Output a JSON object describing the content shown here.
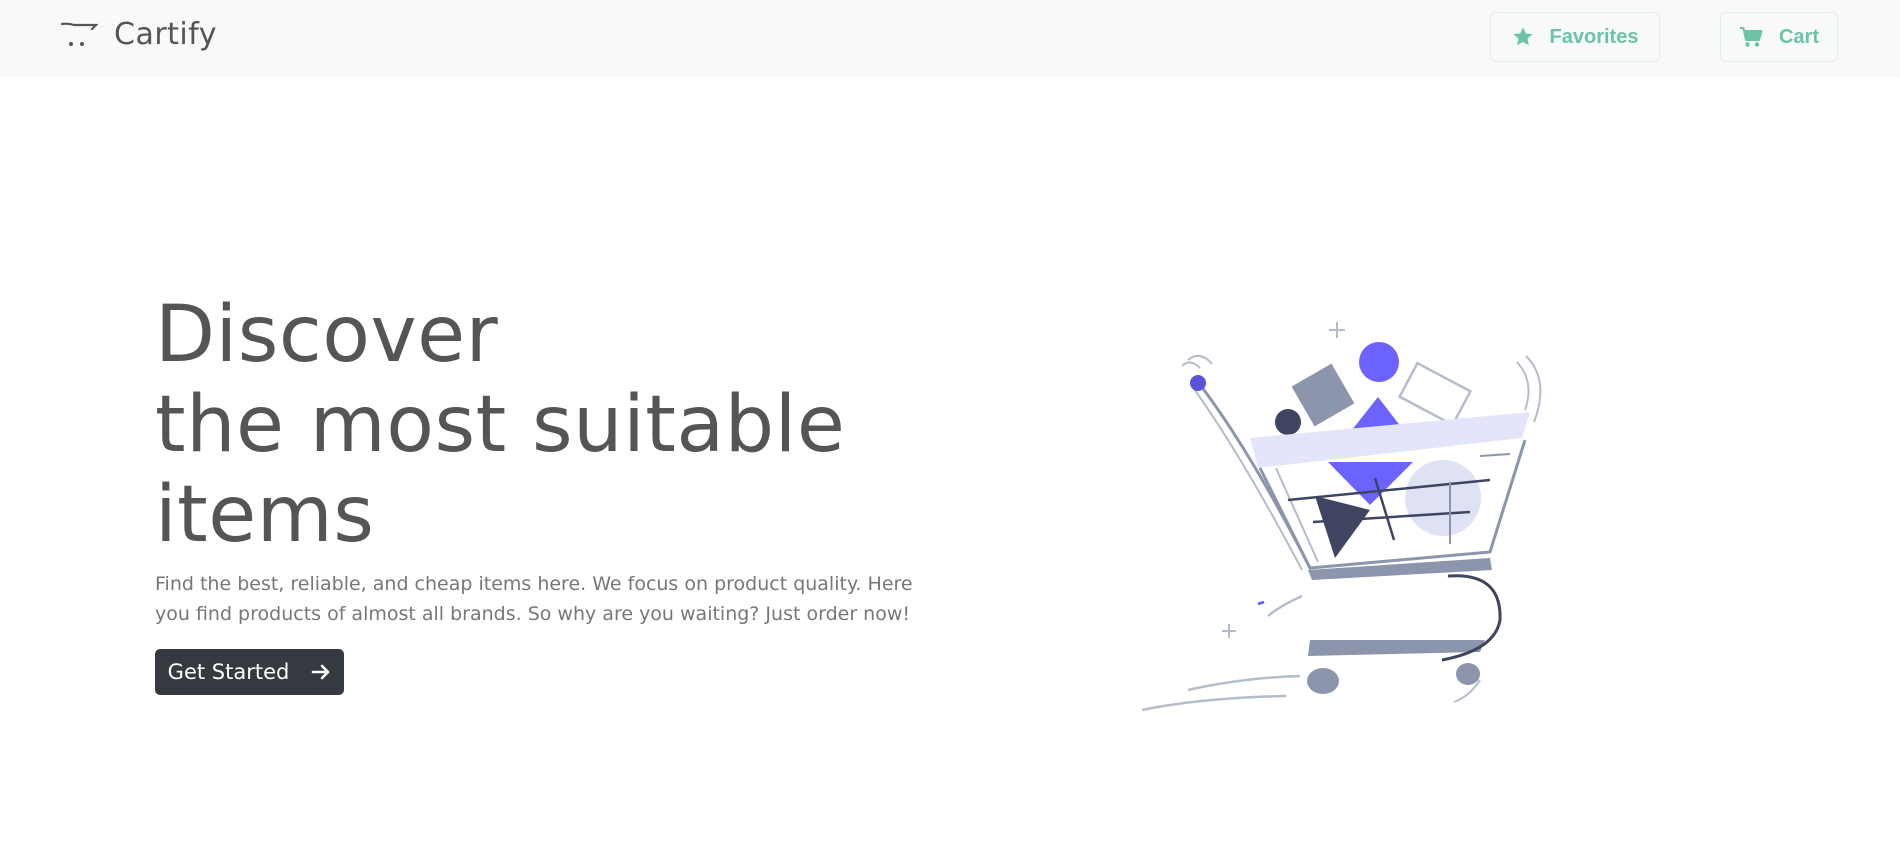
{
  "navbar": {
    "brand": "Cartify",
    "favorites_label": "Favorites",
    "cart_label": "Cart"
  },
  "hero": {
    "title_lines": [
      "Discover",
      "the most suitable",
      "items"
    ],
    "description": "Find the best, reliable, and cheap items here. We focus on product quality. Here you find products of almost all brands. So why are you waiting? Just order now!",
    "cta_label": "Get Started"
  },
  "icons": {
    "brand": "cart-logo-icon",
    "favorites": "star-icon",
    "cart": "cart-icon",
    "cta": "arrow-right-icon",
    "illustration": "shopping-cart-illustration"
  },
  "colors": {
    "accent": "#6cc4a4",
    "dark_button": "#343a40",
    "illustration_primary": "#6c63ff"
  }
}
